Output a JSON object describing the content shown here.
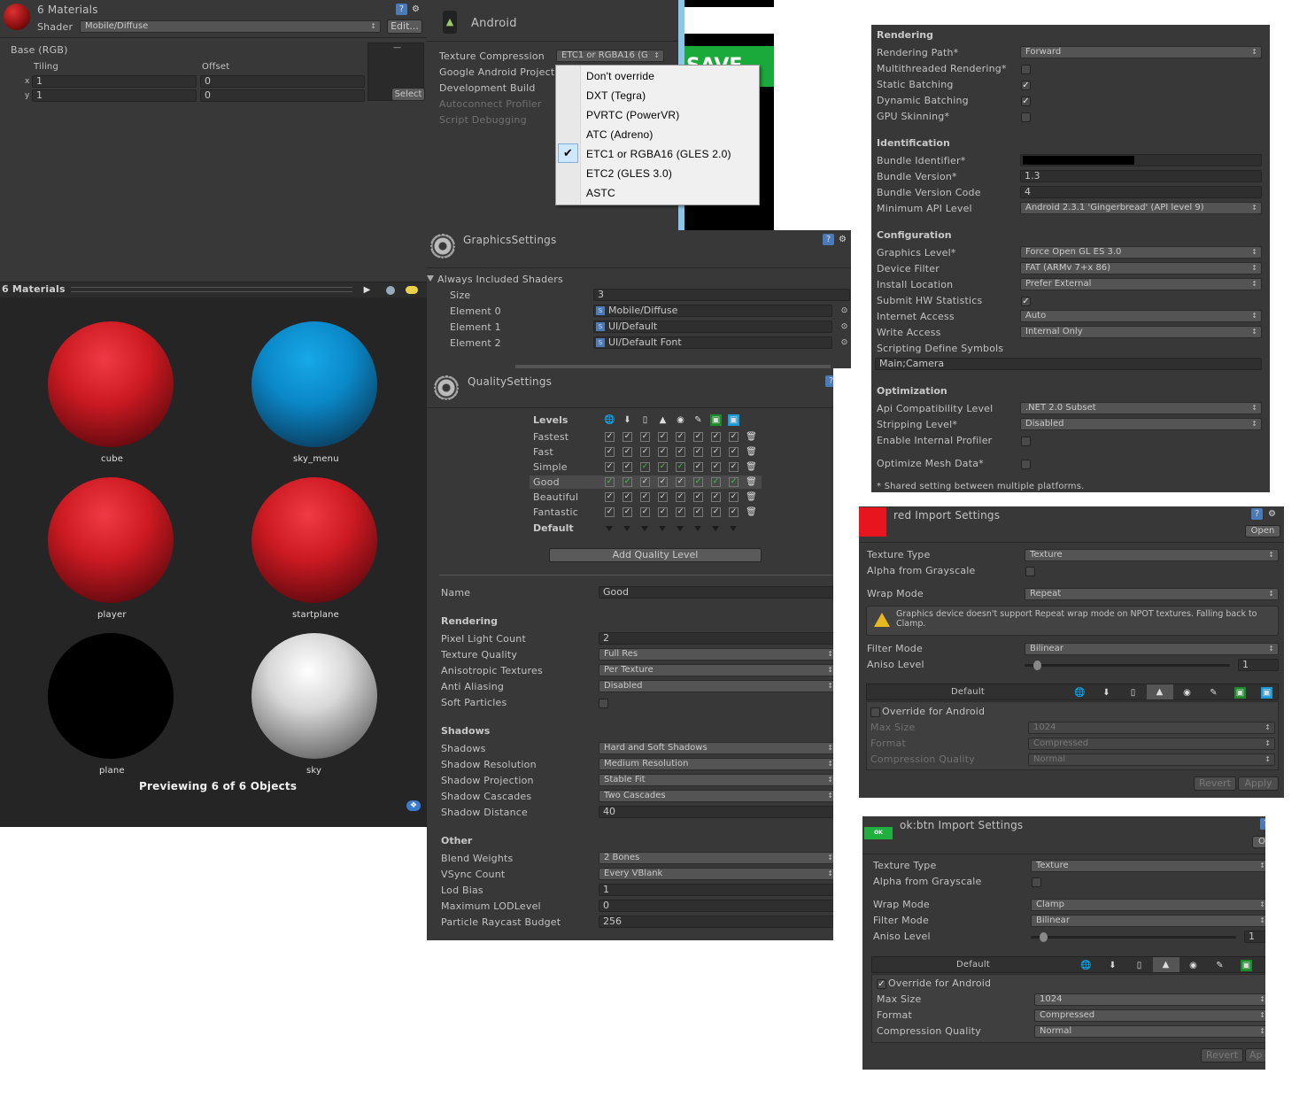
{
  "materials": {
    "title": "6 Materials",
    "shader_label": "Shader",
    "shader_value": "Mobile/Diffuse",
    "edit_button": "Edit...",
    "base_label": "Base (RGB)",
    "tiling_label": "Tiling",
    "offset_label": "Offset",
    "x_label": "x",
    "y_label": "y",
    "tiling_x": "1",
    "tiling_y": "1",
    "offset_x": "0",
    "offset_y": "0",
    "select_button": "Select",
    "texture_dash": "—",
    "preview_title": "6 Materials",
    "preview_items": [
      "cube",
      "sky_menu",
      "player",
      "startplane",
      "plane",
      "sky"
    ],
    "preview_status": "Previewing 6 of 6 Objects"
  },
  "android": {
    "title": "Android",
    "texture_compression_label": "Texture Compression",
    "texture_compression_value": "ETC1 or RGBA16 (G",
    "google_project_label": "Google Android Project",
    "development_build_label": "Development Build",
    "autoconnect_label": "Autoconnect Profiler",
    "script_debugging_label": "Script Debugging",
    "dropdown_options": [
      "Don't override",
      "DXT (Tegra)",
      "PVRTC (PowerVR)",
      "ATC (Adreno)",
      "ETC1 or RGBA16 (GLES 2.0)",
      "ETC2 (GLES 3.0)",
      "ASTC"
    ],
    "game_text": "SAVE"
  },
  "graphics": {
    "title": "GraphicsSettings",
    "always_included": "Always Included Shaders",
    "size_label": "Size",
    "size_value": "3",
    "elements": [
      {
        "label": "Element 0",
        "value": "Mobile/Diffuse"
      },
      {
        "label": "Element 1",
        "value": "UI/Default"
      },
      {
        "label": "Element 2",
        "value": "UI/Default Font"
      }
    ]
  },
  "quality": {
    "title": "QualitySettings",
    "levels_label": "Levels",
    "levels": [
      "Fastest",
      "Fast",
      "Simple",
      "Good",
      "Beautiful",
      "Fantastic"
    ],
    "default_label": "Default",
    "add_button": "Add Quality Level",
    "name_label": "Name",
    "name_value": "Good",
    "rendering_header": "Rendering",
    "pixel_light_label": "Pixel Light Count",
    "pixel_light_value": "2",
    "texture_quality_label": "Texture Quality",
    "texture_quality_value": "Full Res",
    "aniso_textures_label": "Anisotropic Textures",
    "aniso_textures_value": "Per Texture",
    "anti_aliasing_label": "Anti Aliasing",
    "anti_aliasing_value": "Disabled",
    "soft_particles_label": "Soft Particles",
    "shadows_header": "Shadows",
    "shadows_label": "Shadows",
    "shadows_value": "Hard and Soft Shadows",
    "shadow_res_label": "Shadow Resolution",
    "shadow_res_value": "Medium Resolution",
    "shadow_proj_label": "Shadow Projection",
    "shadow_proj_value": "Stable Fit",
    "shadow_casc_label": "Shadow Cascades",
    "shadow_casc_value": "Two Cascades",
    "shadow_dist_label": "Shadow Distance",
    "shadow_dist_value": "40",
    "other_header": "Other",
    "blend_weights_label": "Blend Weights",
    "blend_weights_value": "2 Bones",
    "vsync_label": "VSync Count",
    "vsync_value": "Every VBlank",
    "lod_bias_label": "Lod Bias",
    "lod_bias_value": "1",
    "max_lod_label": "Maximum LODLevel",
    "max_lod_value": "0",
    "particle_budget_label": "Particle Raycast Budget",
    "particle_budget_value": "256"
  },
  "player": {
    "rendering_header": "Rendering",
    "rendering_path_label": "Rendering Path*",
    "rendering_path_value": "Forward",
    "multithreaded_label": "Multithreaded Rendering*",
    "static_batching_label": "Static Batching",
    "dynamic_batching_label": "Dynamic Batching",
    "gpu_skinning_label": "GPU Skinning*",
    "identification_header": "Identification",
    "bundle_id_label": "Bundle Identifier*",
    "bundle_version_label": "Bundle Version*",
    "bundle_version_value": "1.3",
    "bundle_code_label": "Bundle Version Code",
    "bundle_code_value": "4",
    "min_api_label": "Minimum API Level",
    "min_api_value": "Android 2.3.1 'Gingerbread' (API level 9)",
    "configuration_header": "Configuration",
    "graphics_level_label": "Graphics Level*",
    "graphics_level_value": "Force Open GL ES 3.0",
    "device_filter_label": "Device Filter",
    "device_filter_value": "FAT (ARMv 7+x 86)",
    "install_location_label": "Install Location",
    "install_location_value": "Prefer External",
    "submit_hw_label": "Submit HW Statistics",
    "internet_access_label": "Internet Access",
    "internet_access_value": "Auto",
    "write_access_label": "Write Access",
    "write_access_value": "Internal Only",
    "scripting_define_label": "Scripting Define Symbols",
    "scripting_define_value": "Main;Camera",
    "optimization_header": "Optimization",
    "api_compat_label": "Api Compatibility Level",
    "api_compat_value": ".NET 2.0 Subset",
    "stripping_label": "Stripping Level*",
    "stripping_value": "Disabled",
    "internal_profiler_label": "Enable Internal Profiler",
    "optimize_mesh_label": "Optimize Mesh Data*",
    "footnote": "* Shared setting between multiple platforms."
  },
  "red_import": {
    "title": "red Import Settings",
    "open_button": "Open",
    "texture_type_label": "Texture Type",
    "texture_type_value": "Texture",
    "alpha_gray_label": "Alpha from Grayscale",
    "wrap_mode_label": "Wrap Mode",
    "wrap_mode_value": "Repeat",
    "warning": "Graphics device doesn't support Repeat wrap mode on NPOT textures. Falling back to Clamp.",
    "filter_mode_label": "Filter Mode",
    "filter_mode_value": "Bilinear",
    "aniso_label": "Aniso Level",
    "aniso_value": "1",
    "aniso_level": 0.0,
    "default_tab": "Default",
    "override_label": "Override for Android",
    "max_size_label": "Max Size",
    "max_size_value": "1024",
    "format_label": "Format",
    "format_value": "Compressed",
    "compression_label": "Compression Quality",
    "compression_value": "Normal",
    "revert_button": "Revert",
    "apply_button": "Apply",
    "swatch_color": "#e8141e"
  },
  "ok_import": {
    "title": "ok:btn Import Settings",
    "thumb_text": "OK",
    "open_button": "O",
    "texture_type_label": "Texture Type",
    "texture_type_value": "Texture",
    "alpha_gray_label": "Alpha from Grayscale",
    "wrap_mode_label": "Wrap Mode",
    "wrap_mode_value": "Clamp",
    "filter_mode_label": "Filter Mode",
    "filter_mode_value": "Bilinear",
    "aniso_label": "Aniso Level",
    "aniso_value": "1",
    "aniso_level": 0.0,
    "default_tab": "Default",
    "override_label": "Override for Android",
    "max_size_label": "Max Size",
    "max_size_value": "1024",
    "format_label": "Format",
    "format_value": "Compressed",
    "compression_label": "Compression Quality",
    "compression_value": "Normal",
    "revert_button": "Revert",
    "apply_button": "Ap"
  },
  "colors": {
    "panel_bg": "#383838",
    "accent_blue": "#3a9ad9",
    "ok_green": "#20b040",
    "checkbox_green": "#3fcf3f"
  },
  "icons": [
    "help-icon",
    "gear-icon",
    "android-icon",
    "globe-icon",
    "download-icon",
    "phone-icon",
    "blackberry-icon",
    "flash-icon",
    "xbox-icon",
    "windows-icon",
    "trash-icon",
    "warning-icon",
    "shader-icon",
    "object-picker-icon",
    "play-icon",
    "tag-icon"
  ]
}
